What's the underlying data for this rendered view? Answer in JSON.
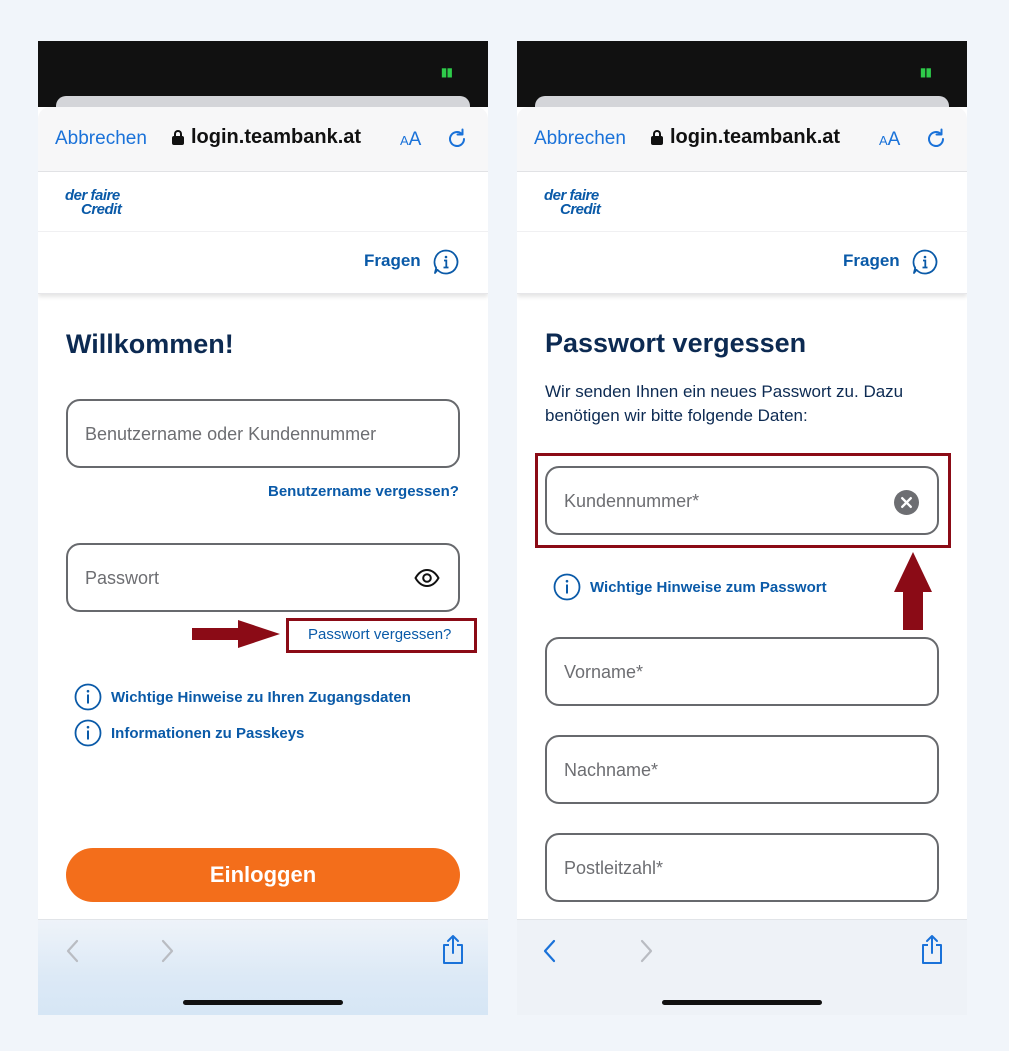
{
  "browser": {
    "cancel_label": "Abbrechen",
    "url": "login.teambank.at",
    "aa_small": "A",
    "aa_large": "A"
  },
  "brand": {
    "logo_line1": "der faire",
    "logo_line2": "Credit",
    "color": "#0a5aa8"
  },
  "header": {
    "help_label": "Fragen"
  },
  "login_screen": {
    "title": "Willkommen!",
    "username_placeholder": "Benutzername oder Kundennummer",
    "forgot_username_link": "Benutzername vergessen?",
    "password_placeholder": "Passwort",
    "forgot_password_link": "Passwort vergessen?",
    "info_links": [
      "Wichtige Hinweise zu Ihren Zugangsdaten",
      "Informationen zu Passkeys"
    ],
    "login_button": "Einloggen",
    "accent_color": "#f36e1b"
  },
  "reset_screen": {
    "title": "Passwort vergessen",
    "description": "Wir senden Ihnen ein neues Passwort zu. Dazu benötigen wir bitte folgende Daten:",
    "customer_number_placeholder": "Kundennummer*",
    "password_hint_link": "Wichtige Hinweise zum Passwort",
    "first_name_placeholder": "Vorname*",
    "last_name_placeholder": "Nachname*",
    "postal_code_placeholder": "Postleitzahl*"
  },
  "annotation_color": "#8b0b16"
}
